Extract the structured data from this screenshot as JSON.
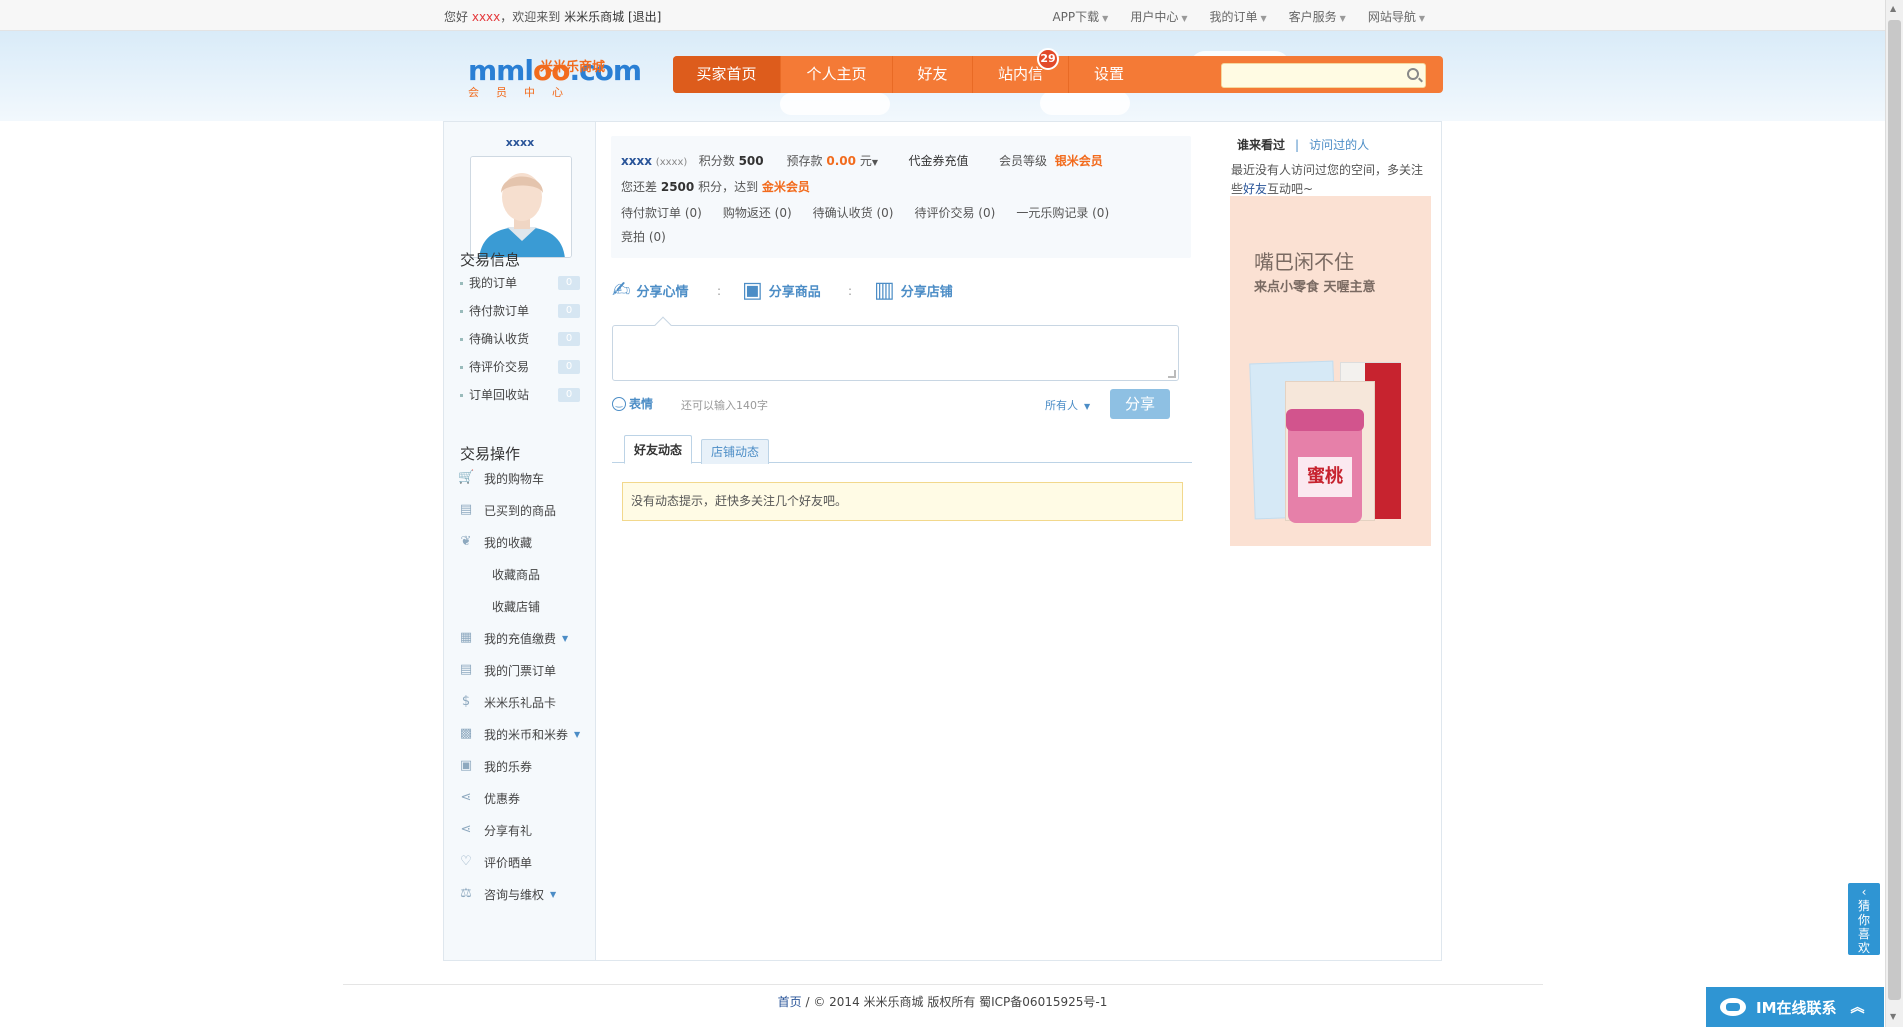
{
  "topbar": {
    "greeting": "您好",
    "user": "xxxx",
    "welcome": "，欢迎来到",
    "site": "米米乐商城",
    "logout": "[退出]",
    "links": [
      "APP下载",
      "用户中心",
      "我的订单",
      "客户服务",
      "网站导航"
    ]
  },
  "logo": {
    "latin_a": "mml",
    "latin_o": "oo",
    "latin_b": ".com",
    "cn_name": "米米乐商城",
    "sub": "会员中心"
  },
  "nav": {
    "items": [
      "买家首页",
      "个人主页",
      "好友",
      "站内信",
      "设置"
    ],
    "message_badge": "29",
    "search_placeholder": ""
  },
  "sidebar": {
    "username": "xxxx",
    "trade_info_title": "交易信息",
    "order_items": [
      {
        "label": "我的订单",
        "count": "0"
      },
      {
        "label": "待付款订单",
        "count": "0"
      },
      {
        "label": "待确认收货",
        "count": "0"
      },
      {
        "label": "待评价交易",
        "count": "0"
      },
      {
        "label": "订单回收站",
        "count": "0"
      }
    ],
    "trade_ops_title": "交易操作",
    "ops": [
      {
        "label": "我的购物车",
        "icon": "cart-icon"
      },
      {
        "label": "已买到的商品",
        "icon": "basket-icon"
      },
      {
        "label": "我的收藏",
        "icon": "ribbon-icon"
      },
      {
        "label": "收藏商品",
        "icon": ""
      },
      {
        "label": "收藏店铺",
        "icon": ""
      },
      {
        "label": "我的充值缴费",
        "icon": "building-icon"
      },
      {
        "label": "我的门票订单",
        "icon": "basket-icon"
      },
      {
        "label": "米米乐礼品卡",
        "icon": "dollar-icon"
      },
      {
        "label": "我的米币和米券",
        "icon": "calculator-icon"
      },
      {
        "label": "我的乐券",
        "icon": "gift-icon"
      },
      {
        "label": "优惠券",
        "icon": "share-icon"
      },
      {
        "label": "分享有礼",
        "icon": "share-icon"
      },
      {
        "label": "评价晒单",
        "icon": "heart-icon"
      },
      {
        "label": "咨询与维权",
        "icon": "scale-icon"
      }
    ]
  },
  "info": {
    "name": "xxxx",
    "name_sub": "(xxxx)",
    "points_label": "积分数",
    "points": "500",
    "deposit_label": "预存款",
    "deposit": "0.00",
    "deposit_unit": "元",
    "voucher_recharge": "代金券充值",
    "level_label": "会员等级",
    "level": "银米会员",
    "remain_a": "您还差",
    "remain_points": "2500",
    "remain_b": "积分，达到",
    "next_level": "金米会员",
    "stats": [
      "待付款订单 (0)",
      "购物返还 (0)",
      "待确认收货 (0)",
      "待评价交易 (0)",
      "一元乐购记录 (0)",
      "竞拍 (0)"
    ]
  },
  "share": {
    "mood": "分享心情",
    "goods": "分享商品",
    "shop": "分享店铺",
    "emoji": "表情",
    "char_count": "还可以输入140字",
    "scope": "所有人",
    "button": "分享"
  },
  "tabs": [
    "好友动态",
    "店铺动态"
  ],
  "notice": "没有动态提示，赶快多关注几个好友吧。",
  "visitors": {
    "title_a": "谁来看过",
    "title_b": "访问过的人",
    "msg_a": "最近没有人访问过您的空间，多关注些",
    "msg_link": "好友",
    "msg_b": "互动吧~"
  },
  "ad": {
    "title": "嘴巴闲不住",
    "subtitle": "来点小零食 天喔主意",
    "label": "蜜桃"
  },
  "footer": {
    "home": "首页",
    "text": " / © 2014 米米乐商城 版权所有 蜀ICP备06015925号-1"
  },
  "widgets": {
    "guess": "猜你喜欢",
    "im": "IM在线联系"
  }
}
